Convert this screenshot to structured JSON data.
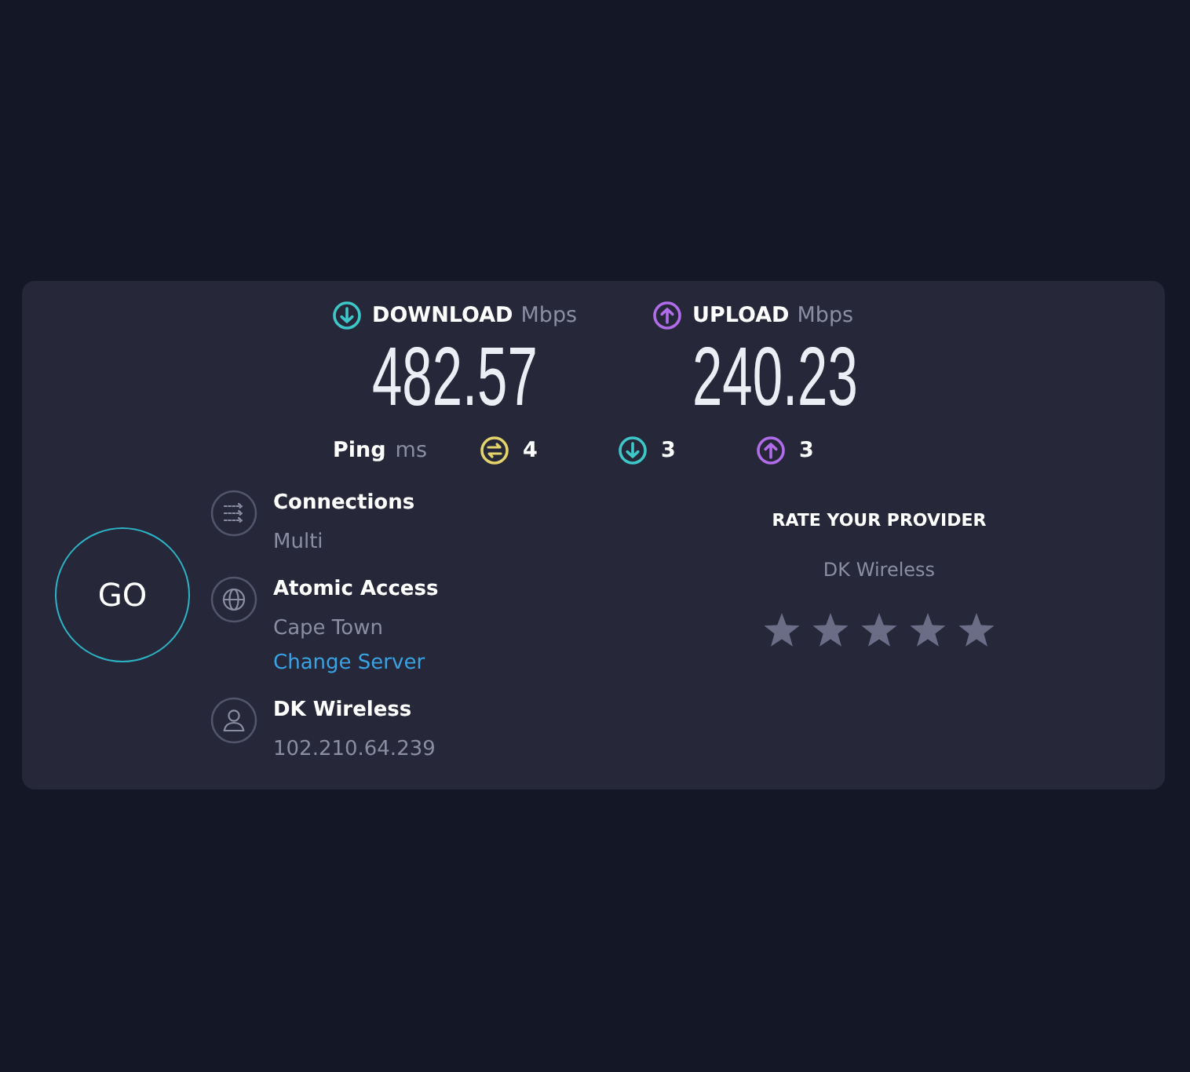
{
  "speeds": [
    {
      "kind": "download",
      "label": "DOWNLOAD",
      "unit": "Mbps",
      "value": "482.57"
    },
    {
      "kind": "upload",
      "label": "UPLOAD",
      "unit": "Mbps",
      "value": "240.23"
    }
  ],
  "ping": {
    "label": "Ping",
    "unit": "ms",
    "readings": [
      {
        "kind": "idle",
        "value": "4"
      },
      {
        "kind": "download",
        "value": "3"
      },
      {
        "kind": "upload",
        "value": "3"
      }
    ]
  },
  "go_button": {
    "label": "GO"
  },
  "details": [
    {
      "kind": "connections",
      "title": "Connections",
      "subtitle": "Multi"
    },
    {
      "kind": "server",
      "title": "Atomic Access",
      "subtitle": "Cape Town",
      "link": "Change Server"
    },
    {
      "kind": "provider",
      "title": "DK Wireless",
      "subtitle": "102.210.64.239"
    }
  ],
  "rating": {
    "title": "RATE YOUR PROVIDER",
    "provider": "DK Wireless"
  }
}
